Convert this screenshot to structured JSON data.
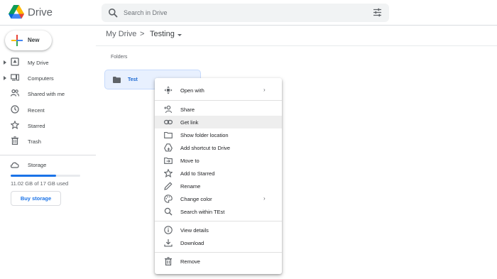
{
  "app": {
    "title": "Drive",
    "logo_icon": "google-drive-logo",
    "colors": {
      "accent": "#1a73e8",
      "selected_bg": "#e8f0fe",
      "hover_bg": "#eeeeee"
    }
  },
  "search": {
    "placeholder": "Search in Drive",
    "value": "",
    "icon": "search-icon",
    "options_icon": "tune-icon"
  },
  "sidebar": {
    "new_label": "New",
    "items": [
      {
        "label": "My Drive",
        "icon": "my-drive-icon",
        "expandable": true
      },
      {
        "label": "Computers",
        "icon": "computer-icon",
        "expandable": true
      },
      {
        "label": "Shared with me",
        "icon": "people-icon",
        "expandable": false
      },
      {
        "label": "Recent",
        "icon": "clock-icon",
        "expandable": false
      },
      {
        "label": "Starred",
        "icon": "star-icon",
        "expandable": false
      },
      {
        "label": "Trash",
        "icon": "trash-icon",
        "expandable": false
      }
    ],
    "storage": {
      "label": "Storage",
      "used_text": "11.02 GB of 17 GB used",
      "used_fraction": 0.648,
      "buy_label": "Buy storage"
    }
  },
  "breadcrumb": {
    "root": "My Drive",
    "separator": ">",
    "current": "Testing"
  },
  "main": {
    "section_title": "Folders",
    "folders": [
      {
        "name": "Test",
        "icon": "folder-icon",
        "selected": true
      }
    ]
  },
  "context_menu": {
    "groups": [
      [
        {
          "label": "Open with",
          "icon": "open-with-icon",
          "submenu": true
        }
      ],
      [
        {
          "label": "Share",
          "icon": "add-person-icon"
        },
        {
          "label": "Get link",
          "icon": "link-icon",
          "highlighted": true
        },
        {
          "label": "Show folder location",
          "icon": "folder-outline-icon"
        },
        {
          "label": "Add shortcut to Drive",
          "icon": "drive-shortcut-icon"
        },
        {
          "label": "Move to",
          "icon": "move-to-icon"
        },
        {
          "label": "Add to Starred",
          "icon": "star-outline-icon"
        },
        {
          "label": "Rename",
          "icon": "pencil-icon"
        },
        {
          "label": "Change color",
          "icon": "palette-icon",
          "submenu": true
        },
        {
          "label": "Search within TEst",
          "icon": "search-icon"
        }
      ],
      [
        {
          "label": "View details",
          "icon": "info-icon"
        },
        {
          "label": "Download",
          "icon": "download-icon"
        }
      ],
      [
        {
          "label": "Remove",
          "icon": "trash-icon"
        }
      ]
    ],
    "submenu_glyph": "›"
  }
}
